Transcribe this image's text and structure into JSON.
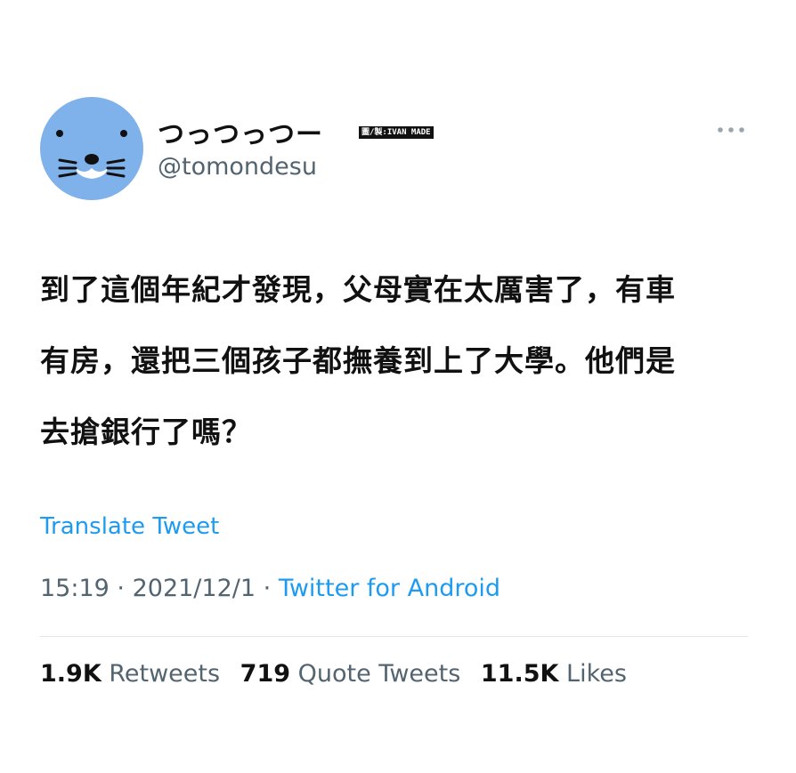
{
  "user": {
    "display_name": "つっつっつー",
    "handle": "@tomondesu",
    "avatar_color": "#7fb1ea"
  },
  "watermark": "圖/製:IVAN MADE",
  "tweet": {
    "lines": [
      "到了這個年紀才發現，父母實在太厲害了，有車",
      "有房，還把三個孩子都撫養到上了大學。他們是",
      "去搶銀行了嗎？"
    ],
    "translate_label": "Translate Tweet",
    "time": "15:19",
    "date": "2021/12/1",
    "separator": "·",
    "source": "Twitter for Android"
  },
  "stats": {
    "retweets_count": "1.9K",
    "retweets_label": "Retweets",
    "quotes_count": "719",
    "quotes_label": "Quote Tweets",
    "likes_count": "11.5K",
    "likes_label": "Likes"
  },
  "colors": {
    "accent": "#1d9bf0",
    "secondary_text": "#536471"
  }
}
